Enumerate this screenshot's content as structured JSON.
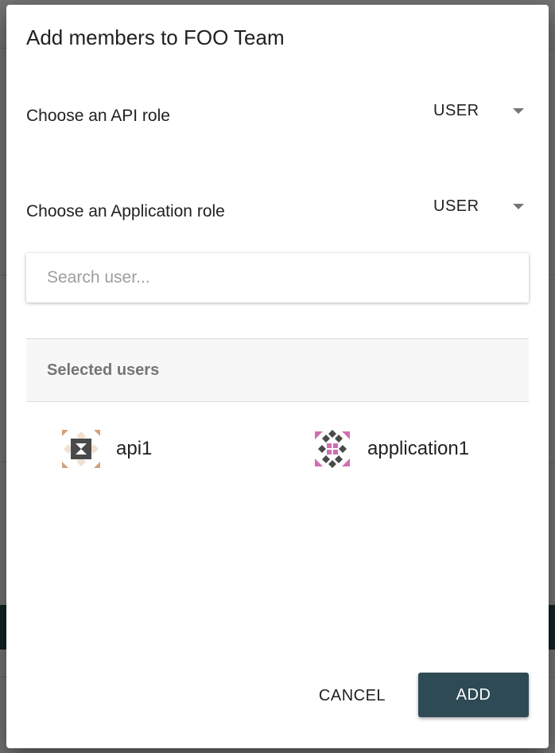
{
  "dialog": {
    "title": "Add members to FOO Team",
    "api_role": {
      "label": "Choose an API role",
      "value": "USER"
    },
    "application_role": {
      "label": "Choose an Application role",
      "value": "USER"
    },
    "search": {
      "placeholder": "Search user...",
      "value": ""
    },
    "selected_users": {
      "heading": "Selected users",
      "users": [
        {
          "name": "api1",
          "avatar": "identicon-avatar",
          "colors": [
            "#d4a27a",
            "#4a4a4a"
          ]
        },
        {
          "name": "application1",
          "avatar": "identicon-avatar",
          "colors": [
            "#d06fb2",
            "#4a4a4a"
          ]
        }
      ]
    },
    "actions": {
      "cancel_label": "CANCEL",
      "add_label": "ADD"
    }
  },
  "theme": {
    "primary": "#2e4a55",
    "overlay": "rgba(0,0,0,0.55)"
  }
}
